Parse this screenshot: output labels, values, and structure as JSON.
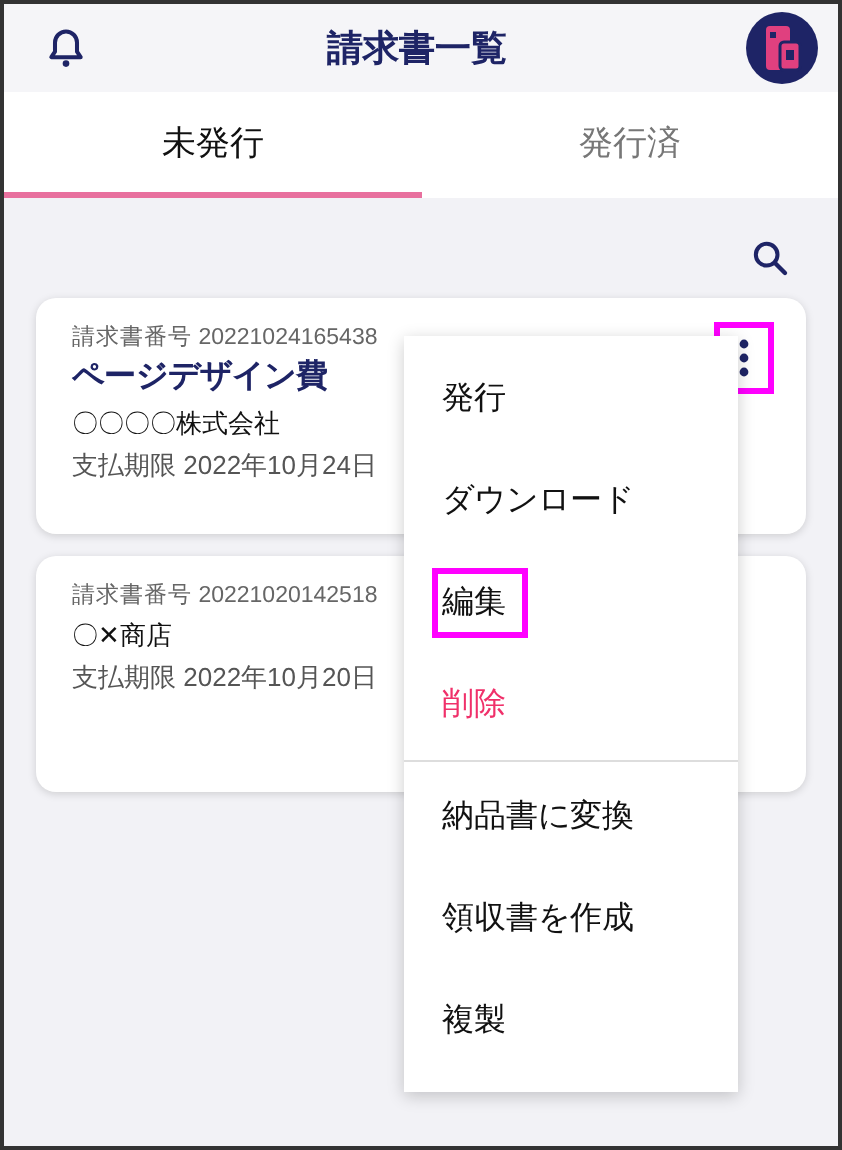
{
  "header": {
    "title": "請求書一覧"
  },
  "tabs": [
    {
      "label": "未発行",
      "selected": true
    },
    {
      "label": "発行済",
      "selected": false
    }
  ],
  "invoices": [
    {
      "number_label": "請求書番号",
      "number": "20221024165438",
      "subject": "ページデザイン費",
      "client": "〇〇〇〇株式会社",
      "due_label": "支払期限",
      "due": "2022年10月24日",
      "menu_button": {
        "highlighted": true
      }
    },
    {
      "number_label": "請求書番号",
      "number": "20221020142518",
      "client": "〇✕商店",
      "due_label": "支払期限",
      "due": "2022年10月20日"
    }
  ],
  "menu": [
    {
      "label": "発行",
      "kind": "normal",
      "highlighted": false
    },
    {
      "label": "ダウンロード",
      "kind": "normal",
      "highlighted": false
    },
    {
      "label": "編集",
      "kind": "normal",
      "highlighted": true
    },
    {
      "label": "削除",
      "kind": "danger",
      "highlighted": false
    },
    {
      "label": "納品書に変換",
      "kind": "normal",
      "divider_before": true,
      "highlighted": false
    },
    {
      "label": "領収書を作成",
      "kind": "normal",
      "highlighted": false
    },
    {
      "label": "複製",
      "kind": "normal",
      "highlighted": false
    }
  ]
}
